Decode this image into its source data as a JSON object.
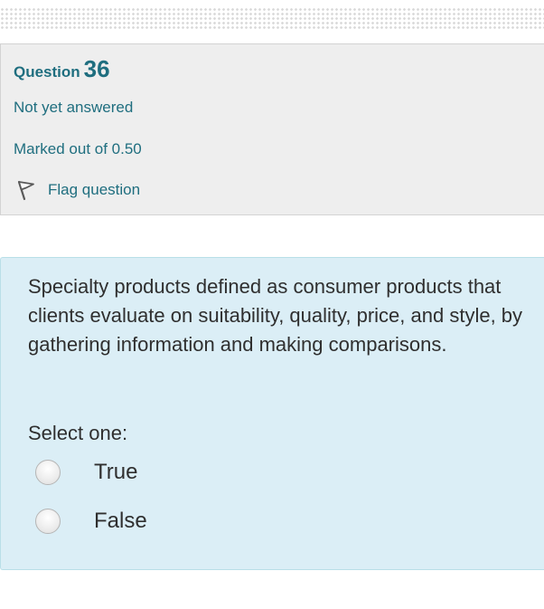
{
  "question_info": {
    "label": "Question",
    "number": "36",
    "state": "Not yet answered",
    "grade": "Marked out of 0.50",
    "flag_label": "Flag question",
    "flag_icon": "flag-icon"
  },
  "question": {
    "text": "Specialty products defined as consumer products that clients evaluate on suitability, quality, price, and style, by gathering information and making comparisons.",
    "prompt": "Select one:",
    "options": [
      {
        "label": "True",
        "selected": false
      },
      {
        "label": "False",
        "selected": false
      }
    ]
  },
  "colors": {
    "accent": "#1f6e7f",
    "info_background": "#eeeeee",
    "content_background": "#dbeef6",
    "content_border": "#b9dfe8",
    "text": "#2f2f2f"
  }
}
